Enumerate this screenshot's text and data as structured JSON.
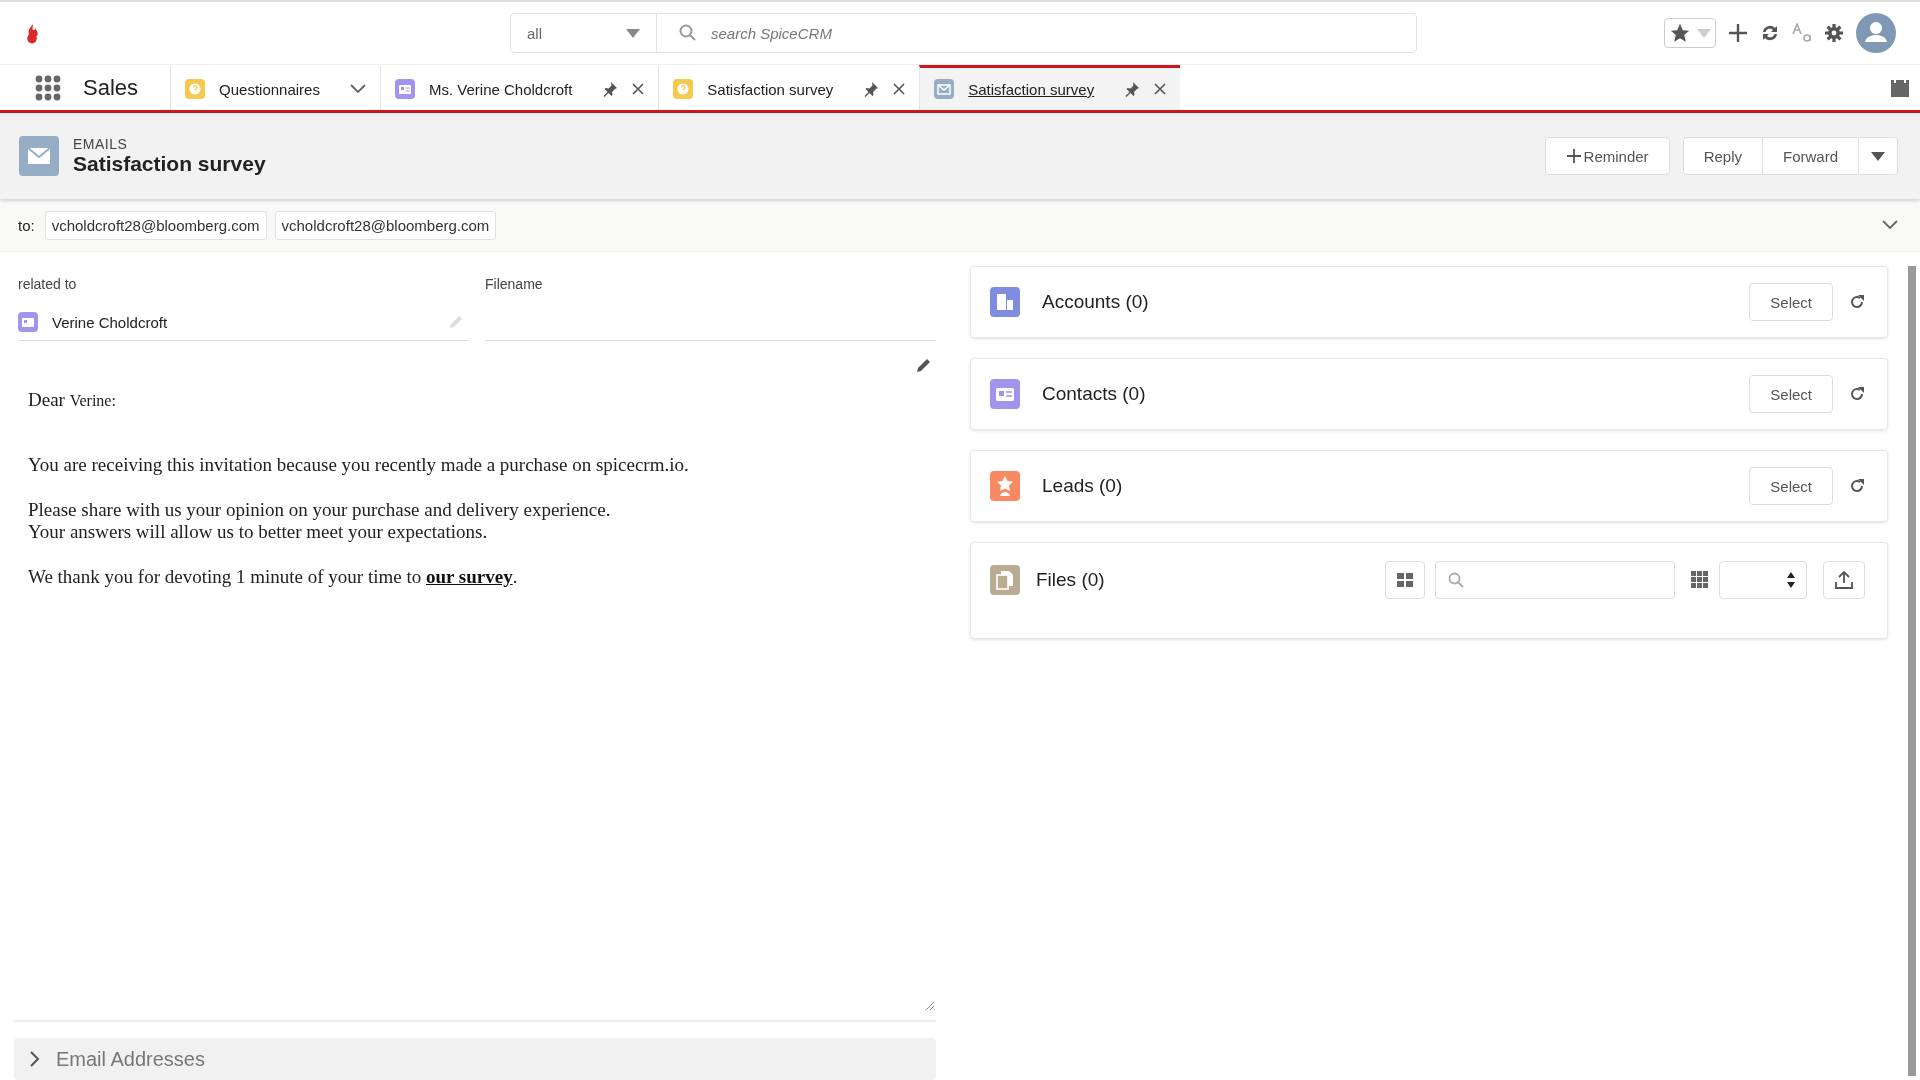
{
  "app": {
    "name": "Sales"
  },
  "search": {
    "scope": "all",
    "placeholder": "search SpiceCRM"
  },
  "tabs": [
    {
      "label": "Questionnaires",
      "kind": "questionnaire",
      "pinnable": false,
      "selected": false
    },
    {
      "label": "Ms. Verine Choldcroft",
      "kind": "contact",
      "pinnable": true,
      "selected": false
    },
    {
      "label": "Satisfaction survey",
      "kind": "questionnaire",
      "pinnable": true,
      "selected": false
    },
    {
      "label": "Satisfaction survey",
      "kind": "email",
      "pinnable": true,
      "selected": true
    }
  ],
  "record": {
    "module": "EMAILS",
    "title": "Satisfaction survey"
  },
  "actions": {
    "reminder": "Reminder",
    "reply": "Reply",
    "forward": "Forward"
  },
  "recipients": {
    "label": "to:",
    "addresses": [
      "vcholdcroft28@bloomberg.com",
      "vcholdcroft28@bloomberg.com"
    ]
  },
  "related": {
    "label": "related to",
    "value": "Verine Choldcroft"
  },
  "filename": {
    "label": "Filename"
  },
  "body": {
    "greeting": "Dear",
    "name": "Verine:",
    "paragraphs": [
      {
        "lines": [
          "You are receiving this invitation because you recently made a purchase on spicecrm.io."
        ]
      },
      {
        "lines": [
          "Please share with us your opinion on your purchase and delivery experience.",
          "Your answers will allow us to better meet your expectations."
        ]
      },
      {
        "lines": [
          "We thank you for devoting 1 minute of your time to"
        ],
        "link": "our survey",
        "after": "."
      }
    ]
  },
  "sections": [
    {
      "label": "Email Addresses",
      "expanded": false
    }
  ],
  "panels": [
    {
      "title": "Accounts (0)",
      "kind": "accounts",
      "color": "#7f8de1",
      "button": "Select"
    },
    {
      "title": "Contacts (0)",
      "kind": "contacts",
      "color": "#a094ed",
      "button": "Select"
    },
    {
      "title": "Leads (0)",
      "kind": "leads",
      "color": "#f88962",
      "button": "Select"
    },
    {
      "title": "Files (0)",
      "kind": "files",
      "color": "#baac93"
    }
  ]
}
